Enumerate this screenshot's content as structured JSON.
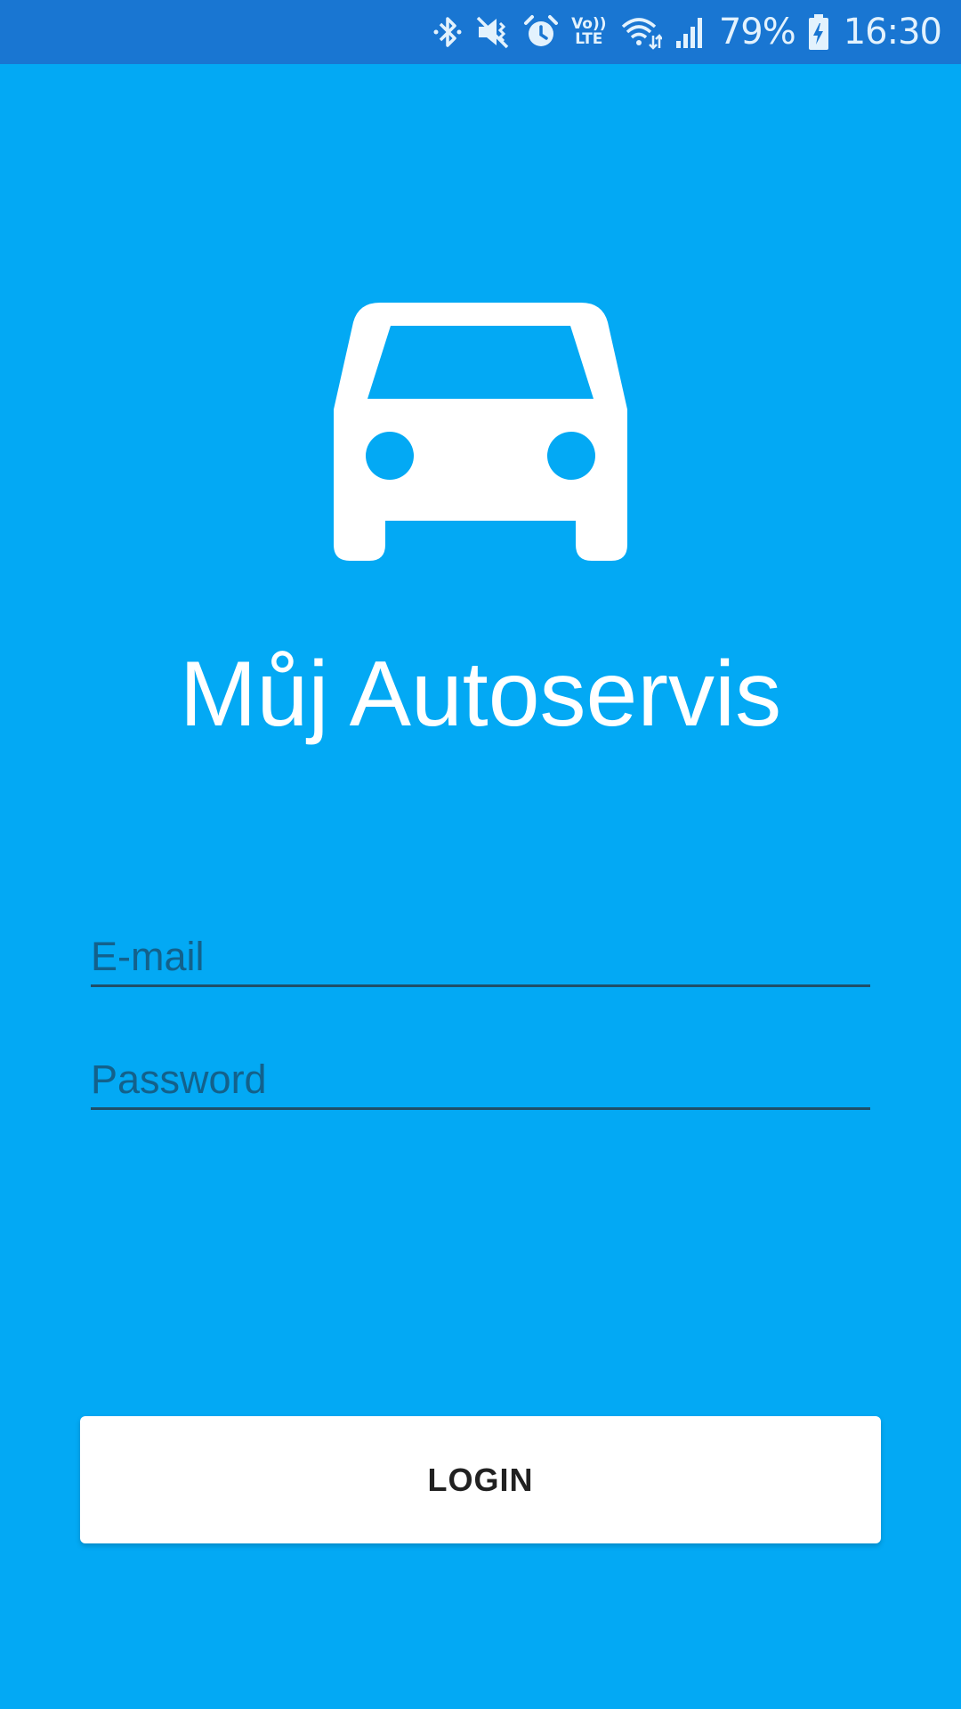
{
  "status_bar": {
    "volte_top": "Vo))",
    "volte_bottom": "LTE",
    "battery_percent": "79%",
    "time": "16:30",
    "icons": [
      "bluetooth-icon",
      "vibrate-mute-icon",
      "alarm-icon",
      "volte-icon",
      "wifi-icon",
      "signal-icon",
      "battery-charging-icon"
    ]
  },
  "app": {
    "logo_icon": "car-icon",
    "title": "Můj Autoservis"
  },
  "form": {
    "email_placeholder": "E-mail",
    "email_value": "",
    "password_placeholder": "Password",
    "password_value": ""
  },
  "actions": {
    "login_label": "LOGIN"
  },
  "colors": {
    "background": "#03A9F4",
    "status_bar": "#1976D2",
    "button": "#FFFFFF",
    "text_primary": "#FFFFFF"
  }
}
